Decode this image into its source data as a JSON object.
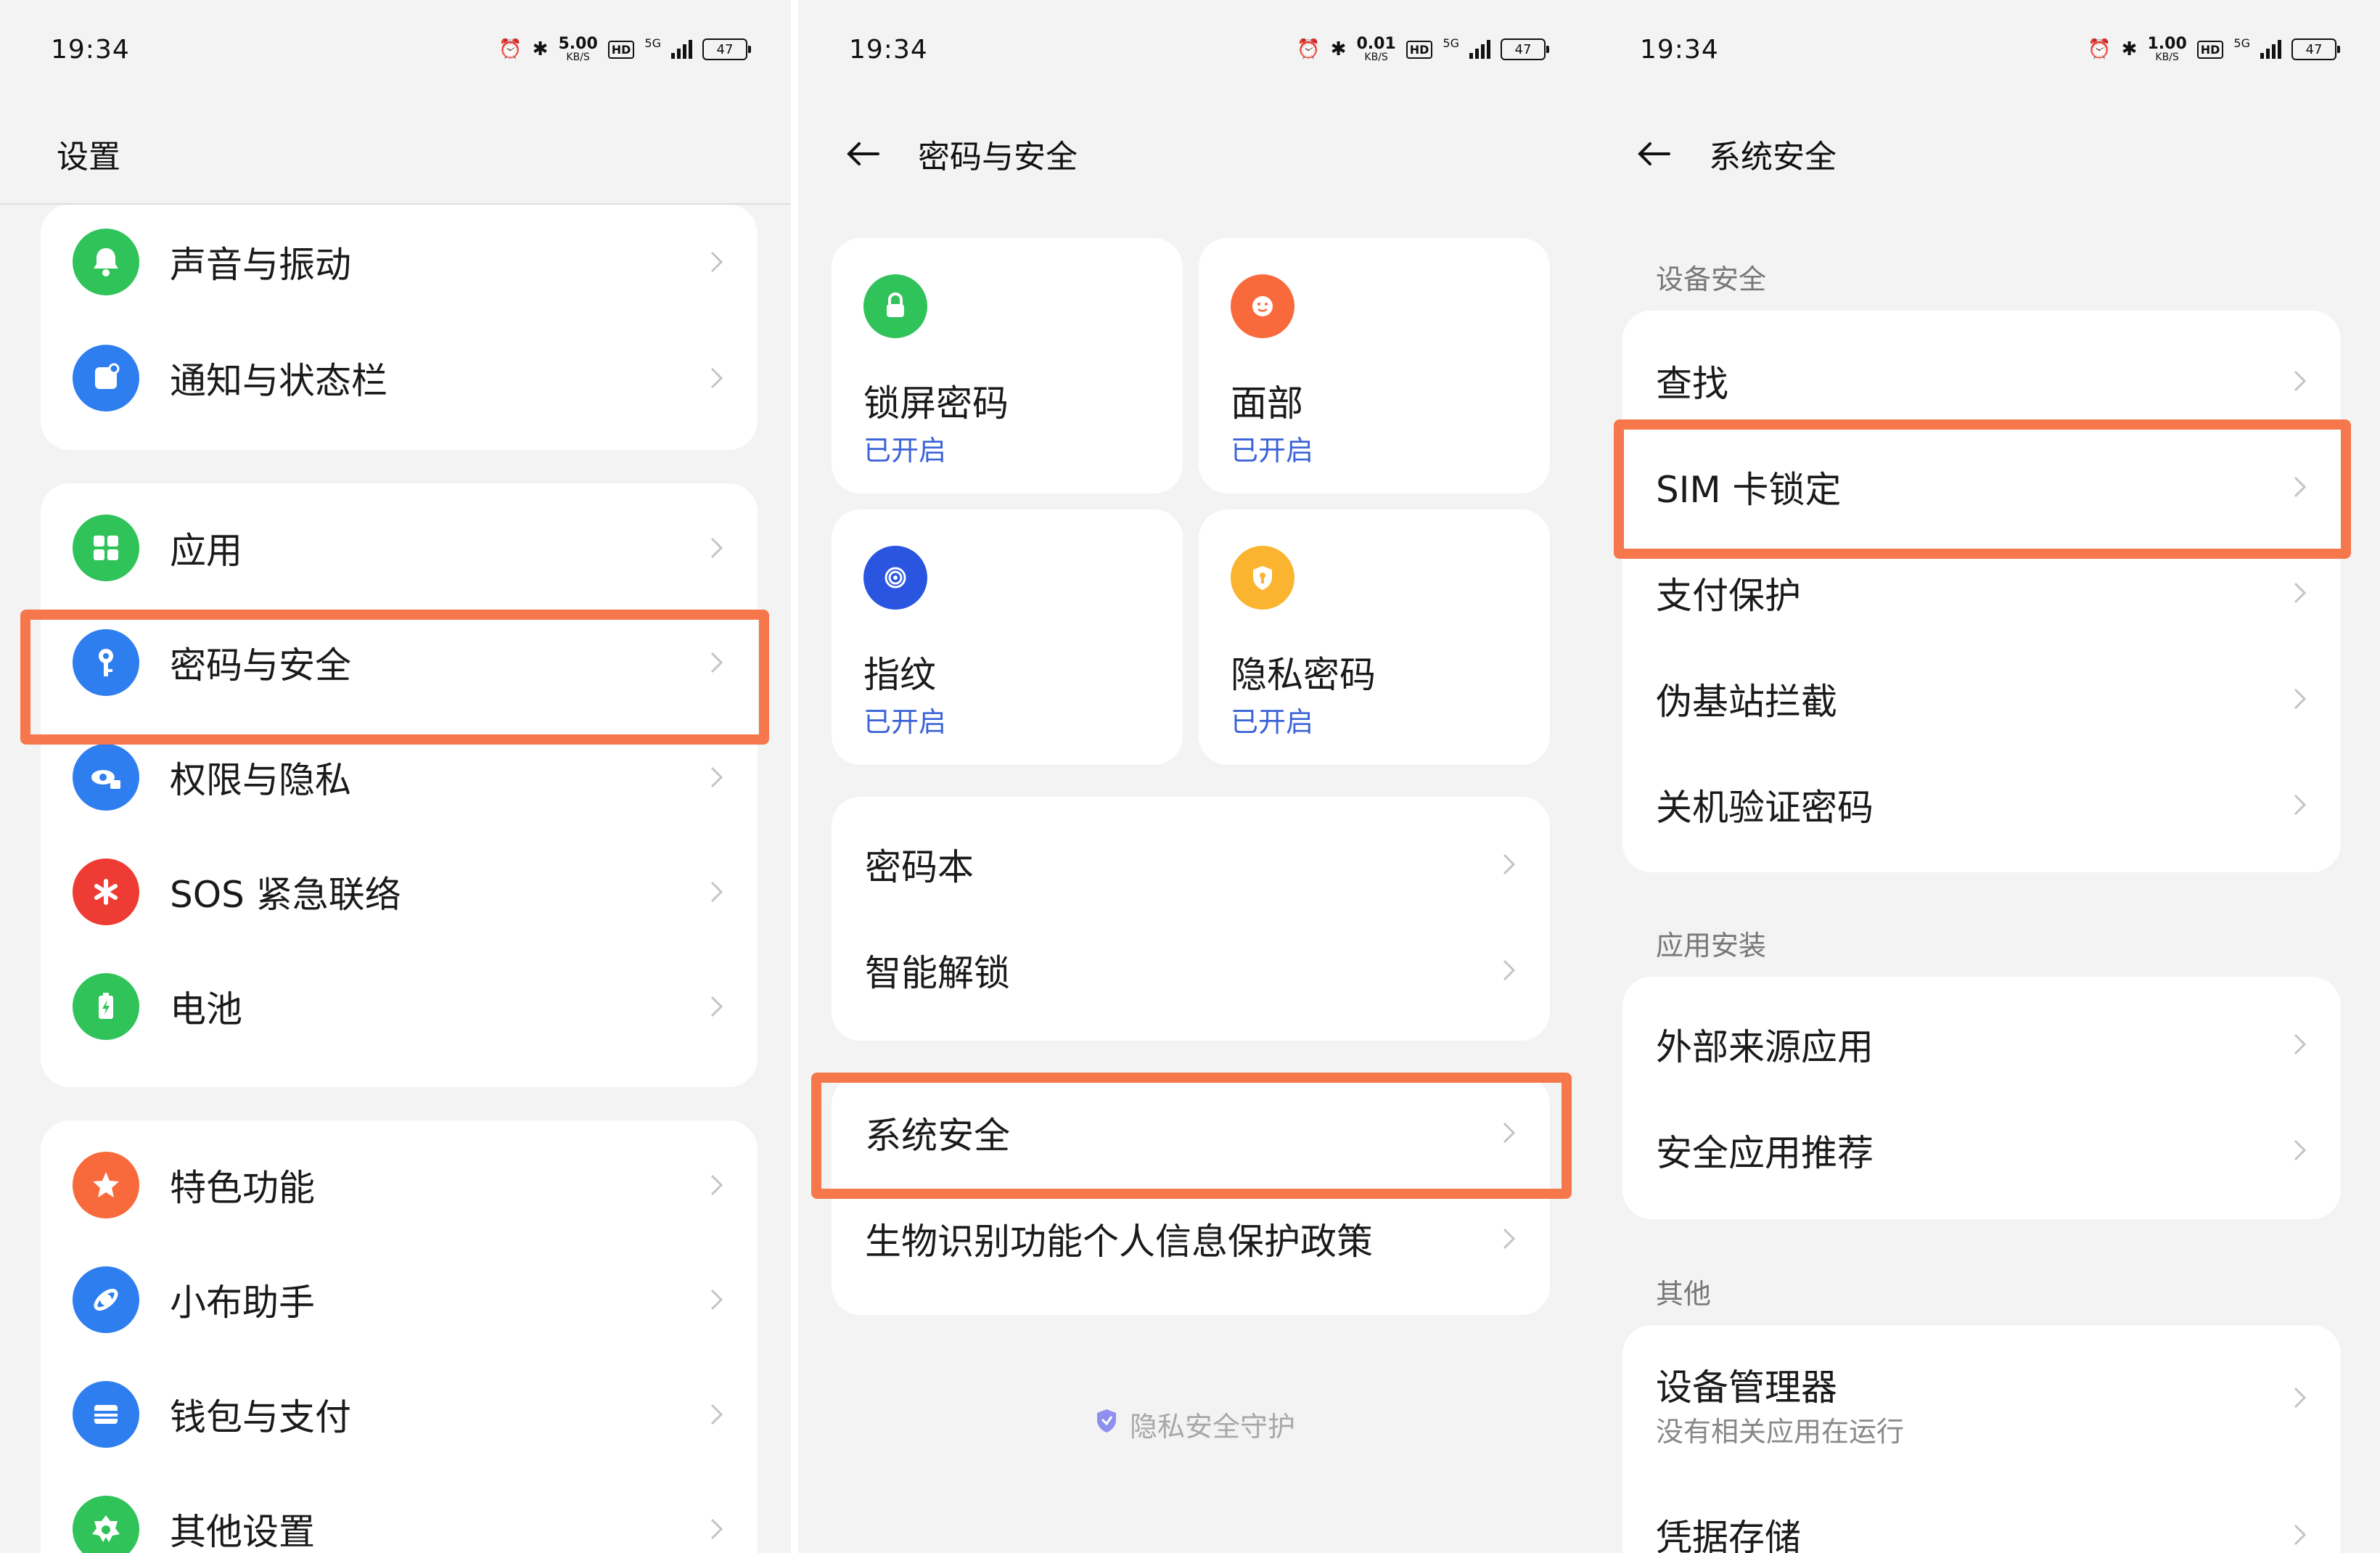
{
  "status_bar": {
    "time": "19:34",
    "battery": "47",
    "hd": "HD",
    "signal_label": "5G",
    "net_units": "KB/S",
    "net_p1": "5.00",
    "net_p2": "0.01",
    "net_p3": "1.00"
  },
  "colors": {
    "highlight": "#f6774b",
    "status_blue": "#3a63d8",
    "green": "#2fc35a",
    "blue": "#2f7ef0",
    "red": "#ee3b33",
    "orange": "#f86a3b",
    "amber": "#fbb42f",
    "indigo": "#2a55e0"
  },
  "panel1": {
    "title": "设置",
    "group1": [
      {
        "label": "声音与振动",
        "icon": "bell-icon"
      },
      {
        "label": "通知与状态栏",
        "icon": "notification-icon"
      }
    ],
    "group2": [
      {
        "label": "应用",
        "icon": "apps-grid-icon"
      },
      {
        "label": "密码与安全",
        "icon": "key-icon"
      },
      {
        "label": "权限与隐私",
        "icon": "eye-lock-icon"
      },
      {
        "label": "SOS 紧急联络",
        "icon": "sos-asterisk-icon"
      },
      {
        "label": "电池",
        "icon": "battery-icon"
      }
    ],
    "group3": [
      {
        "label": "特色功能",
        "icon": "star-icon"
      },
      {
        "label": "小布助手",
        "icon": "assistant-icon"
      },
      {
        "label": "钱包与支付",
        "icon": "wallet-icon"
      },
      {
        "label": "其他设置",
        "icon": "gear-icon"
      }
    ]
  },
  "panel2": {
    "title": "密码与安全",
    "tiles": [
      {
        "title": "锁屏密码",
        "status": "已开启",
        "icon": "lock-icon"
      },
      {
        "title": "面部",
        "status": "已开启",
        "icon": "face-icon"
      },
      {
        "title": "指纹",
        "status": "已开启",
        "icon": "fingerprint-icon"
      },
      {
        "title": "隐私密码",
        "status": "已开启",
        "icon": "shield-key-icon"
      }
    ],
    "group1": [
      "密码本",
      "智能解锁"
    ],
    "group2": [
      "系统安全",
      "生物识别功能个人信息保护政策"
    ],
    "footer": "隐私安全守护"
  },
  "panel3": {
    "title": "系统安全",
    "section1": "设备安全",
    "group1": [
      "查找",
      "SIM 卡锁定",
      "支付保护",
      "伪基站拦截",
      "关机验证密码"
    ],
    "section2": "应用安装",
    "group2": [
      "外部来源应用",
      "安全应用推荐"
    ],
    "section3": "其他",
    "group3_title": "设备管理器",
    "group3_sub": "没有相关应用在运行",
    "group3_next": "凭据存储"
  }
}
